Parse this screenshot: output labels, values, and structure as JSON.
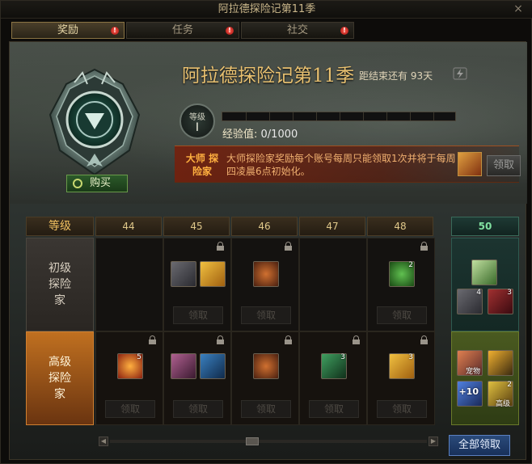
{
  "window": {
    "title": "阿拉德探险记第11季",
    "close_glyph": "×"
  },
  "tabs": [
    {
      "label": "奖励",
      "active": true,
      "alert": true
    },
    {
      "label": "任务",
      "active": false,
      "alert": true
    },
    {
      "label": "社交",
      "active": false,
      "alert": true
    }
  ],
  "season": {
    "title": "阿拉德探险记第11季",
    "remaining": "距结束还有 93天",
    "buy_label": "购买"
  },
  "level": {
    "label": "等级",
    "value": "I",
    "xp_label": "经验值:",
    "xp_value": "0/1000",
    "progress": 0
  },
  "master": {
    "title": "大师 探险家",
    "description": "大师探险家奖励每个账号每周只能领取1次并将于每周四凌晨6点初始化。",
    "claim_label": "领取"
  },
  "grid": {
    "header_label": "等级",
    "levels": [
      "44",
      "45",
      "46",
      "47",
      "48",
      "50"
    ],
    "rows": [
      {
        "name": "初级 探险家",
        "cells": [
          {
            "locked": false,
            "items": [],
            "claim": ""
          },
          {
            "locked": true,
            "items": [
              {
                "icon": "box-icon",
                "qty": ""
              },
              {
                "icon": "gold-chest-icon",
                "qty": ""
              }
            ],
            "claim": "领取"
          },
          {
            "locked": true,
            "items": [
              {
                "icon": "pouch-icon",
                "qty": ""
              }
            ],
            "claim": "领取"
          },
          {
            "locked": false,
            "items": [],
            "claim": ""
          },
          {
            "locked": true,
            "items": [
              {
                "icon": "green-gem-icon",
                "qty": "2"
              }
            ],
            "claim": "领取"
          }
        ],
        "final_items": [
          {
            "icon": "cube-icon",
            "qty": ""
          },
          {
            "icon": "box-icon",
            "qty": "4"
          },
          {
            "icon": "red-crystal-icon",
            "qty": "3"
          }
        ]
      },
      {
        "name": "高级 探险家",
        "cells": [
          {
            "locked": true,
            "items": [
              {
                "icon": "sun-orb-icon",
                "qty": "5"
              }
            ],
            "claim": "领取"
          },
          {
            "locked": true,
            "items": [
              {
                "icon": "pink-box-icon",
                "qty": ""
              },
              {
                "icon": "blue-scroll-icon",
                "qty": ""
              }
            ],
            "claim": "领取"
          },
          {
            "locked": true,
            "items": [
              {
                "icon": "pouch-icon",
                "qty": ""
              }
            ],
            "claim": "领取"
          },
          {
            "locked": true,
            "items": [
              {
                "icon": "ticket-icon",
                "qty": "3"
              }
            ],
            "claim": "领取"
          },
          {
            "locked": true,
            "items": [
              {
                "icon": "gold-chest-icon",
                "qty": "3"
              }
            ],
            "claim": "领取"
          }
        ],
        "final_items": [
          {
            "icon": "portal-icon",
            "qty": ""
          },
          {
            "icon": "dark-orb-icon",
            "qty": ""
          },
          {
            "icon": "plus10-icon",
            "qty": ""
          },
          {
            "icon": "gold-ticket-icon",
            "qty": "2"
          }
        ]
      }
    ]
  },
  "final_item_captions": {
    "portal": "宠物",
    "plus10": "+10",
    "gold_ticket": "高级"
  },
  "claim_all_label": "全部领取",
  "colors": {
    "accent_gold": "#e8c070",
    "master_red": "#8a2a10",
    "claim_all_blue": "#2a4a7a"
  }
}
